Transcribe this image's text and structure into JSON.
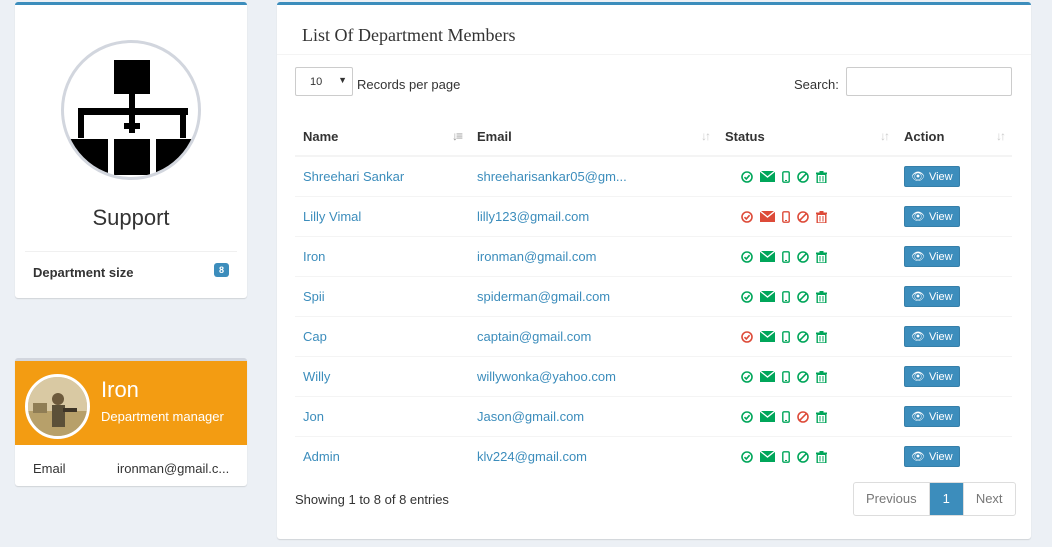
{
  "colors": {
    "accent": "#3c8dbc",
    "warning": "#f39c12",
    "ok": "#00a65a",
    "danger": "#dd4b39"
  },
  "department": {
    "name": "Support",
    "size_label": "Department size",
    "size_count": "8",
    "logo_icon": "org-chart-icon"
  },
  "manager": {
    "name": "Iron",
    "role": "Department manager",
    "email_label": "Email",
    "email": "ironman@gmail.c..."
  },
  "list": {
    "title": "List Of Department Members",
    "page_length": "10",
    "length_label": "Records per page",
    "search_label": "Search:",
    "search_value": "",
    "columns": [
      "Name",
      "Email",
      "Status",
      "Action"
    ],
    "view_label": "View",
    "rows": [
      {
        "name": "Shreehari Sankar",
        "email": "shreeharisankar05@gm...",
        "status": [
          "ok",
          "ok",
          "ok",
          "ok",
          "ok"
        ]
      },
      {
        "name": "Lilly Vimal",
        "email": "lilly123@gmail.com",
        "status": [
          "bad",
          "bad",
          "bad",
          "bad",
          "bad"
        ]
      },
      {
        "name": "Iron",
        "email": "ironman@gmail.com",
        "status": [
          "ok",
          "ok",
          "ok",
          "ok",
          "ok"
        ]
      },
      {
        "name": "Spii",
        "email": "spiderman@gmail.com",
        "status": [
          "ok",
          "ok",
          "ok",
          "ok",
          "ok"
        ]
      },
      {
        "name": "Cap",
        "email": "captain@gmail.com",
        "status": [
          "bad",
          "ok",
          "ok",
          "ok",
          "ok"
        ]
      },
      {
        "name": "Willy",
        "email": "willywonka@yahoo.com",
        "status": [
          "ok",
          "ok",
          "ok",
          "ok",
          "ok"
        ]
      },
      {
        "name": "Jon",
        "email": "Jason@gmail.com",
        "status": [
          "ok",
          "ok",
          "ok",
          "bad",
          "ok"
        ]
      },
      {
        "name": "Admin",
        "email": "klv224@gmail.com",
        "status": [
          "ok",
          "ok",
          "ok",
          "ok",
          "ok"
        ]
      }
    ],
    "status_icons": [
      "check-circle-icon",
      "envelope-icon",
      "mobile-icon",
      "ban-icon",
      "trash-icon"
    ],
    "info": "Showing 1 to 8 of 8 entries",
    "pager": {
      "previous": "Previous",
      "current": "1",
      "next": "Next"
    }
  }
}
